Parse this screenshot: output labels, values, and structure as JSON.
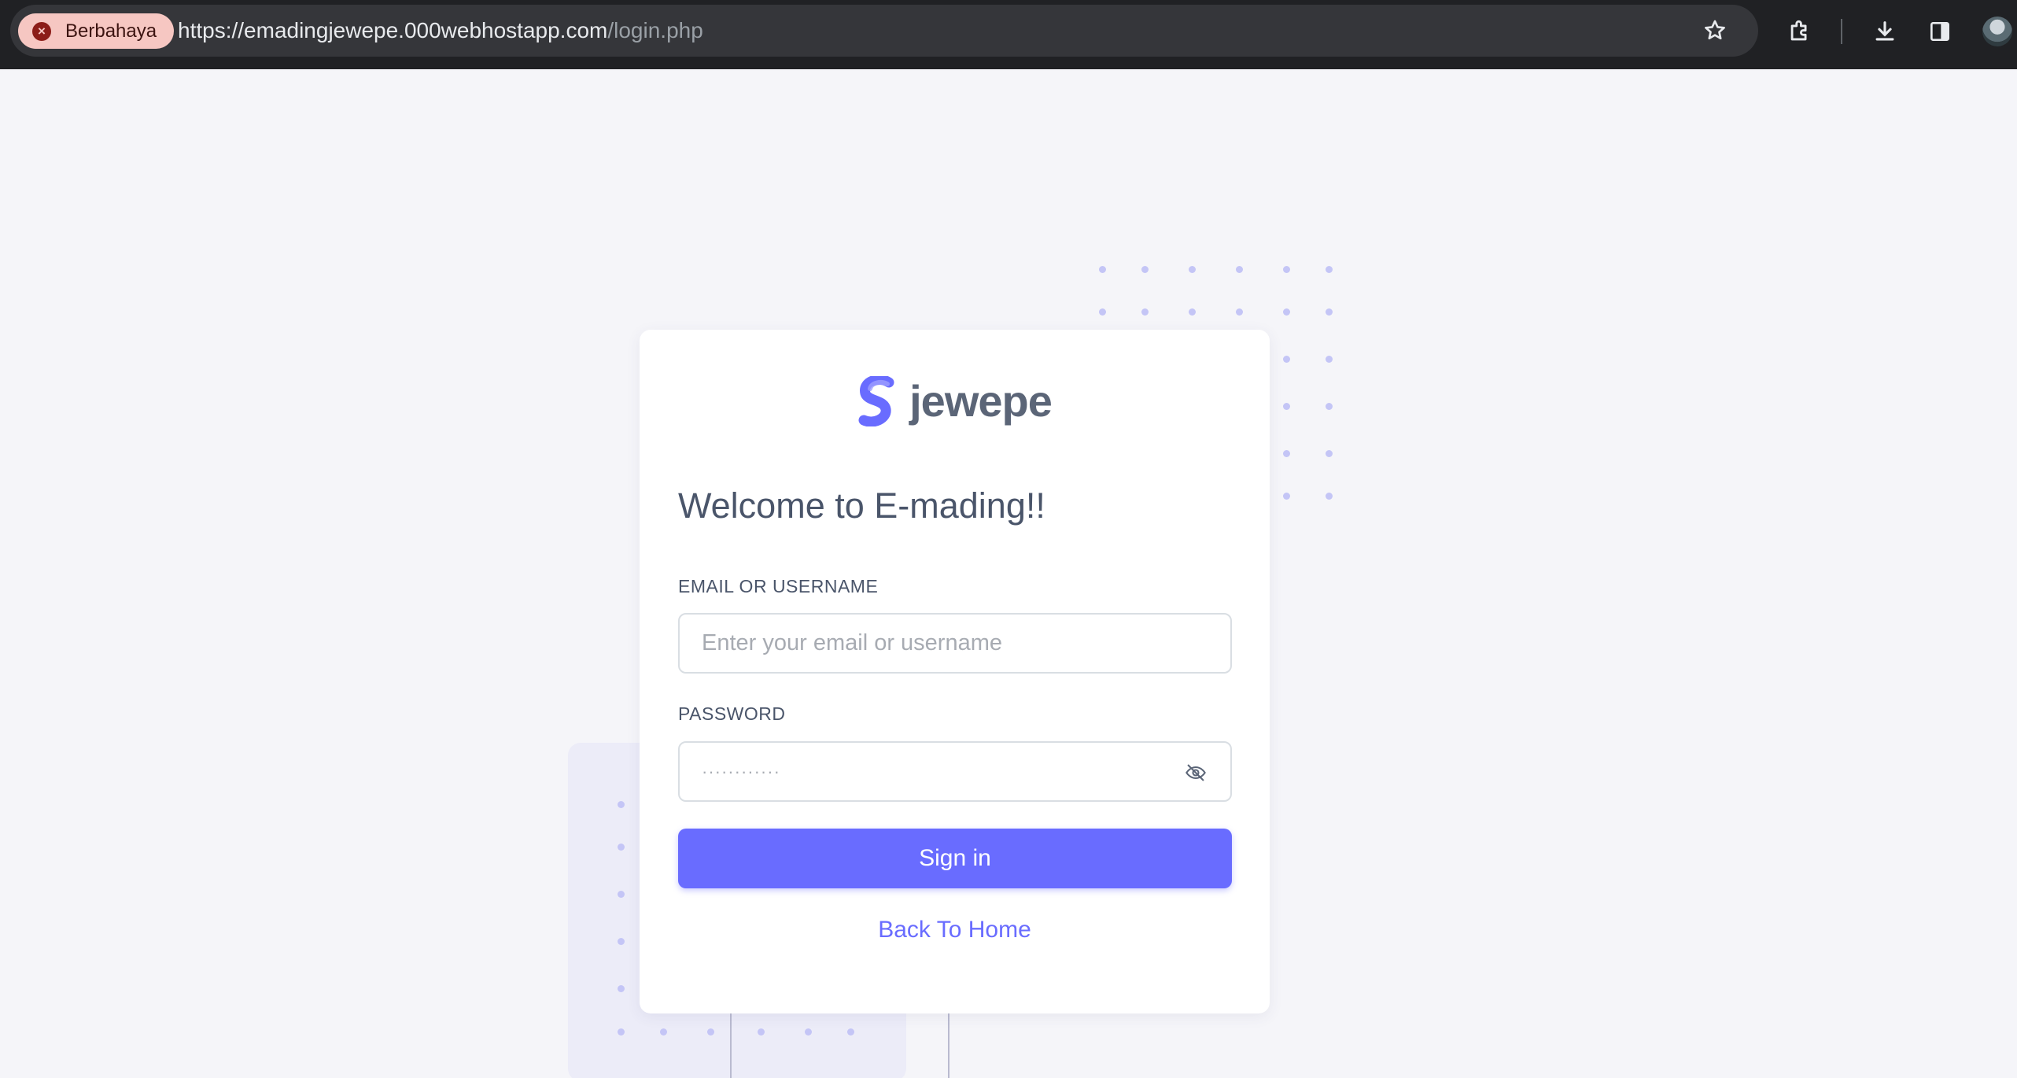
{
  "browser": {
    "security_chip": "Berbahaya",
    "url_host": "https://emadingjewepe.000webhostapp.com",
    "url_path": "/login.php",
    "icons": [
      "bookmark-star-icon",
      "extensions-icon",
      "download-icon",
      "side-panel-icon",
      "profile-avatar"
    ]
  },
  "brand": {
    "name": "jewepe",
    "logo_color": "#696cff"
  },
  "login": {
    "heading": "Welcome to E-mading!!",
    "email_label": "EMAIL OR USERNAME",
    "email_placeholder": "Enter your email or username",
    "password_label": "PASSWORD",
    "password_value": "············",
    "sign_in_label": "Sign in",
    "back_home_label": "Back To Home"
  },
  "colors": {
    "accent": "#696cff",
    "danger_chip_bg": "#f6c7c2",
    "page_bg": "#f5f5f9"
  }
}
